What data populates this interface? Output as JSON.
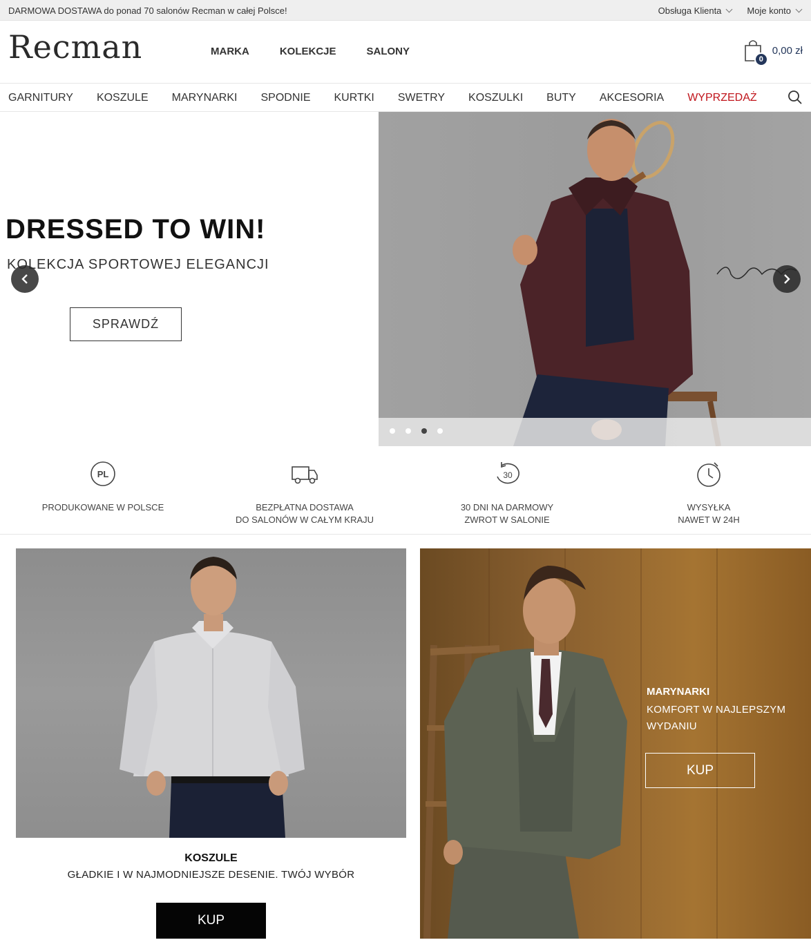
{
  "topbar": {
    "promo": "DARMOWA DOSTAWA do ponad 70 salonów Recman w całej Polsce!",
    "links": [
      "Obsługa Klienta",
      "Moje konto"
    ]
  },
  "header": {
    "logo": "Recman",
    "nav": [
      "MARKA",
      "KOLEKCJE",
      "SALONY"
    ],
    "cart": {
      "count": "0",
      "total": "0,00 zł",
      "icon": "shopping-bag-icon"
    }
  },
  "categories": [
    "GARNITURY",
    "KOSZULE",
    "MARYNARKI",
    "SPODNIE",
    "KURTKI",
    "SWETRY",
    "KOSZULKI",
    "BUTY",
    "AKCESORIA",
    "WYPRZEDAŻ"
  ],
  "hero": {
    "title": "DRESSED TO WIN!",
    "subtitle": "KOLEKCJA SPORTOWEJ ELEGANCJI",
    "button": "SPRAWDŹ",
    "slides": 4,
    "active_slide": 3
  },
  "features": [
    {
      "icon": "pl-badge-icon",
      "line1": "PRODUKOWANE W POLSCE",
      "line2": ""
    },
    {
      "icon": "delivery-truck-icon",
      "line1": "BEZPŁATNA DOSTAWA",
      "line2": "DO SALONÓW W CAŁYM KRAJU"
    },
    {
      "icon": "return-30-icon",
      "line1": "30 DNI NA DARMOWY",
      "line2": "ZWROT W SALONIE"
    },
    {
      "icon": "stopwatch-icon",
      "line1": "WYSYŁKA",
      "line2": "NAWET W 24H"
    }
  ],
  "tiles": {
    "left": {
      "title": "KOSZULE",
      "subtitle": "GŁADKIE I W NAJMODNIEJSZE DESENIE. TWÓJ WYBÓR",
      "button": "KUP"
    },
    "right": {
      "title": "MARYNARKI",
      "subtitle": "KOMFORT W NAJLEPSZYM WYDANIU",
      "button": "KUP"
    }
  },
  "colors": {
    "accent": "#24375b",
    "sale": "#c0141b"
  }
}
